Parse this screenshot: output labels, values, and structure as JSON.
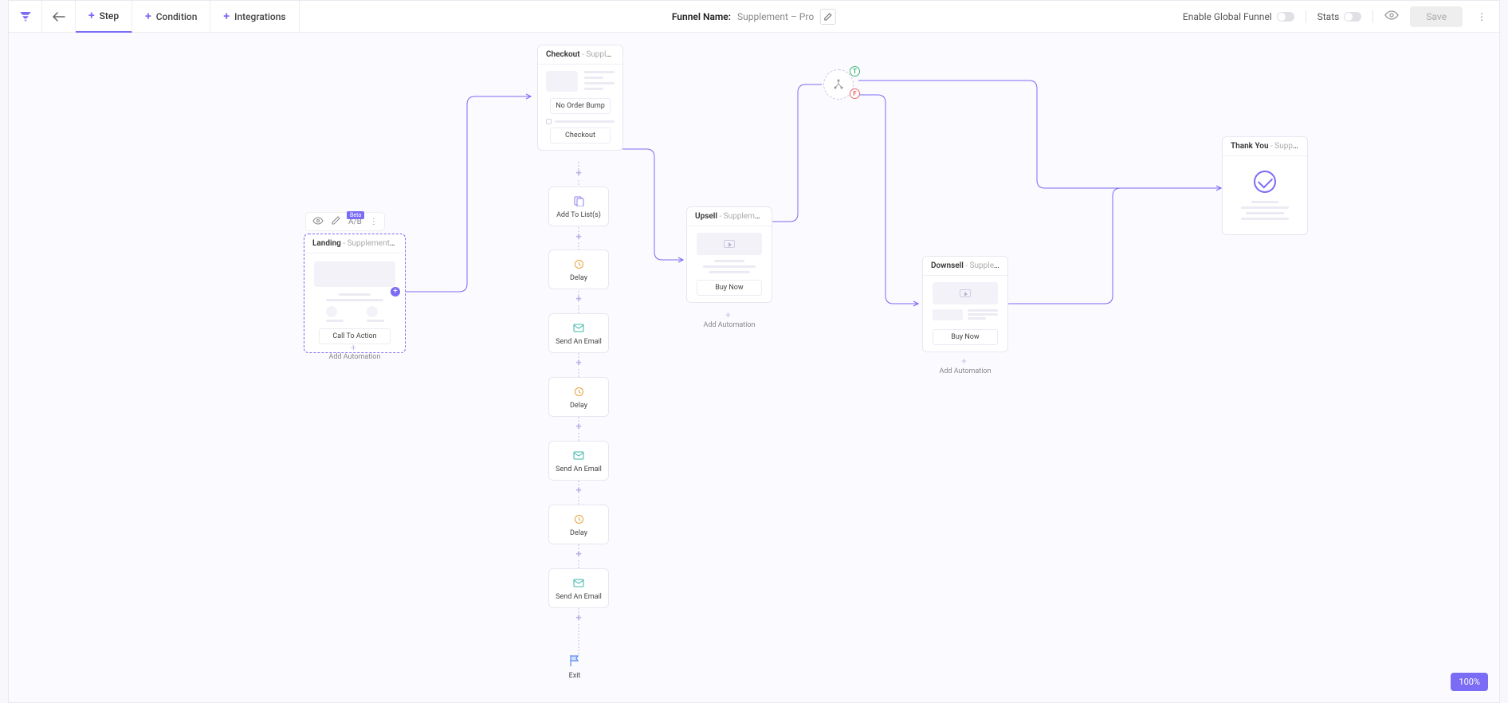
{
  "header": {
    "tabs": {
      "step": "Step",
      "condition": "Condition",
      "integrations": "Integrations"
    },
    "funnel_label": "Funnel Name:",
    "funnel_value": "Supplement – Pro",
    "enable_global": "Enable Global Funnel",
    "stats": "Stats",
    "save": "Save"
  },
  "toolbar": {
    "ab": "A/B",
    "beta": "Beta"
  },
  "cards": {
    "landing": {
      "title": "Landing",
      "sub": "- Supplement La...",
      "cta": "Call To Action",
      "add_auto": "Add Automation"
    },
    "checkout": {
      "title": "Checkout",
      "sub": "- Supplement C...",
      "no_bump": "No Order Bump",
      "checkout_btn": "Checkout"
    },
    "addlist": "Add To List(s)",
    "delay": "Delay",
    "email": "Send An Email",
    "exit": "Exit",
    "upsell": {
      "title": "Upsell",
      "sub": "- Supplement U...",
      "buy": "Buy Now",
      "add_auto": "Add Automation"
    },
    "downsell": {
      "title": "Downsell",
      "sub": "- Supplement D...",
      "buy": "Buy Now",
      "add_auto": "Add Automation"
    },
    "thankyou": {
      "title": "Thank You",
      "sub": "- Supplement T..."
    }
  },
  "split": {
    "t": "T",
    "f": "F"
  },
  "zoom": "100%",
  "colors": {
    "primary": "#7b6cf6",
    "green": "#3cb37d",
    "red": "#e86a6a",
    "orange": "#e8a13a",
    "teal": "#3bb5a8",
    "blue": "#5b8def"
  }
}
